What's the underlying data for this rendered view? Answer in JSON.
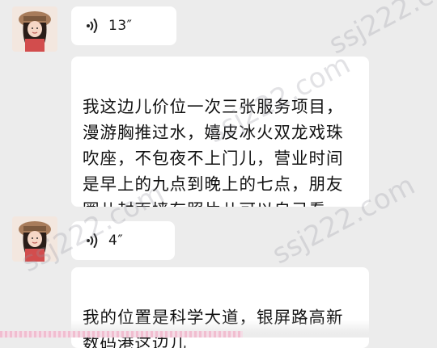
{
  "messages": [
    {
      "type": "voice",
      "duration": "13″"
    },
    {
      "type": "text",
      "text": "我这边儿价位一次三张服务项目，\n漫游胸推过水，嬉皮冰火双龙戏珠\n吹座，不包夜不上门儿，营业时间\n是早上的九点到晚上的七点，朋友\n圈儿封面墙有照片儿可以自己看。"
    },
    {
      "type": "voice",
      "duration": "4″"
    },
    {
      "type": "text",
      "text": "我的位置是科学大道，银屏路高新\n数码港这边儿"
    }
  ],
  "watermarks": [
    "ssj222.com",
    "ssj222.com",
    "ssj222.com",
    "ssj222.com"
  ],
  "icons": {
    "avatar": "avatar-girl-hat-icon",
    "voice": "voice-wave-icon"
  },
  "colors": {
    "background": "#ececec",
    "bubble": "#ffffff",
    "text": "#111111"
  }
}
